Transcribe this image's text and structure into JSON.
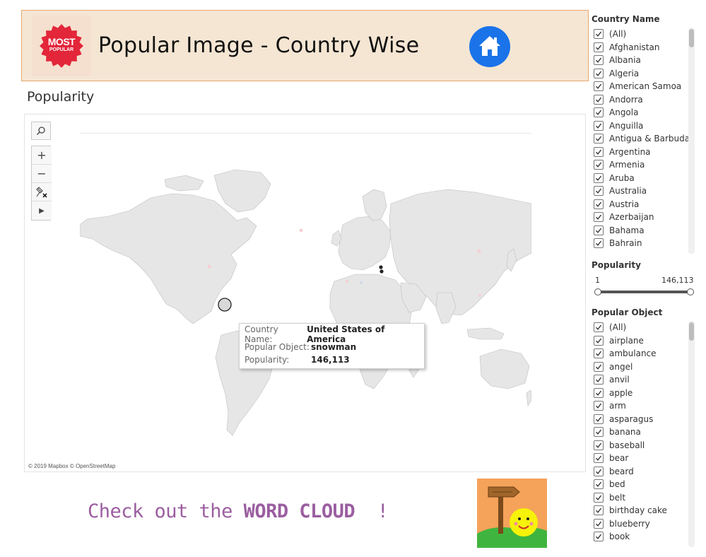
{
  "header": {
    "title": "Popular Image - Country Wise",
    "logo_line1": "MOST",
    "logo_line2": "POPULAR"
  },
  "section_title": "Popularity",
  "map": {
    "attribution": "© 2019 Mapbox © OpenStreetMap",
    "tools": [
      "search-icon",
      "zoom-in-icon",
      "zoom-out-icon",
      "clear-pins-icon",
      "play-icon"
    ],
    "tool_glyphs": {
      "zoom_in": "+",
      "zoom_out": "−",
      "play": "▶"
    }
  },
  "tooltip": {
    "keys": {
      "country": "Country Name:",
      "object": "Popular Object:",
      "popularity": "Popularity:"
    },
    "values": {
      "country": "United States of America",
      "object": "snowman",
      "popularity": "146,113"
    }
  },
  "cta": {
    "prefix": "Check out the ",
    "bold": "WORD CLOUD",
    "suffix": "  !"
  },
  "filters": {
    "country": {
      "title": "Country Name",
      "items": [
        "(All)",
        "Afghanistan",
        "Albania",
        "Algeria",
        "American Samoa",
        "Andorra",
        "Angola",
        "Anguilla",
        "Antigua & Barbuda",
        "Argentina",
        "Armenia",
        "Aruba",
        "Australia",
        "Austria",
        "Azerbaijan",
        "Bahama",
        "Bahrain"
      ]
    },
    "popularity": {
      "title": "Popularity",
      "min_label": "1",
      "max_label": "146,113",
      "range_fraction": [
        0,
        1
      ]
    },
    "object": {
      "title": "Popular Object",
      "items": [
        "(All)",
        "airplane",
        "ambulance",
        "angel",
        "anvil",
        "apple",
        "arm",
        "asparagus",
        "banana",
        "baseball",
        "bear",
        "beard",
        "bed",
        "belt",
        "birthday cake",
        "blueberry",
        "book"
      ]
    }
  },
  "colors": {
    "header_bg": "#f5e6d3",
    "header_border": "#e8a86f",
    "home_blue": "#1a73e8",
    "logo_red": "#e3263a",
    "cta_purple": "#9b5ea0",
    "land": "#e6e6e6"
  }
}
